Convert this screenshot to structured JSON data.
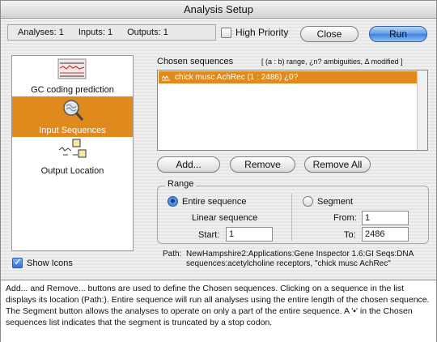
{
  "window": {
    "title": "Analysis Setup"
  },
  "header": {
    "analyses": "Analyses: 1",
    "inputs": "Inputs: 1",
    "outputs": "Outputs: 1",
    "priority_label": "High Priority",
    "priority_checked": false,
    "close_label": "Close",
    "run_label": "Run"
  },
  "sidebar": {
    "items": [
      {
        "label": "GC coding prediction",
        "icon": "gc-chart-icon",
        "selected": false
      },
      {
        "label": "Input Sequences",
        "icon": "magnifier-sequence-icon",
        "selected": true
      },
      {
        "label": "Output Location",
        "icon": "output-location-icon",
        "selected": false
      }
    ],
    "show_icons_label": "Show Icons",
    "show_icons_checked": true
  },
  "chosen": {
    "title": "Chosen sequences",
    "legend": "[ (a : b) range, ¿n? ambiguities, Δ modified ]",
    "rows": [
      {
        "text": "chick musc AchRec  (1 : 2486) ¿0?",
        "selected": true
      }
    ],
    "add_label": "Add...",
    "remove_label": "Remove",
    "remove_all_label": "Remove All"
  },
  "range": {
    "title": "Range",
    "entire_label": "Entire sequence",
    "entire_selected": true,
    "linear_label": "Linear sequence",
    "start_label": "Start:",
    "start_value": "1",
    "segment_label": "Segment",
    "segment_selected": false,
    "from_label": "From:",
    "from_value": "1",
    "to_label": "To:",
    "to_value": "2486"
  },
  "path": {
    "label": "Path:",
    "value": "NewHampshire2:Applications:Gene Inspector 1.6:GI Seqs:DNA sequences:acetylcholine receptors, \"chick musc AchRec\""
  },
  "help_text": "Add... and Remove... buttons are used to define the Chosen sequences. Clicking on a sequence in the list displays its location (Path:). Entire sequence will run all analyses using the entire length of the chosen sequence. The Segment button allows the analyses to operate on only a part of the entire sequence. A '•' in the Chosen sequences list indicates that the segment is truncated by a stop codon."
}
